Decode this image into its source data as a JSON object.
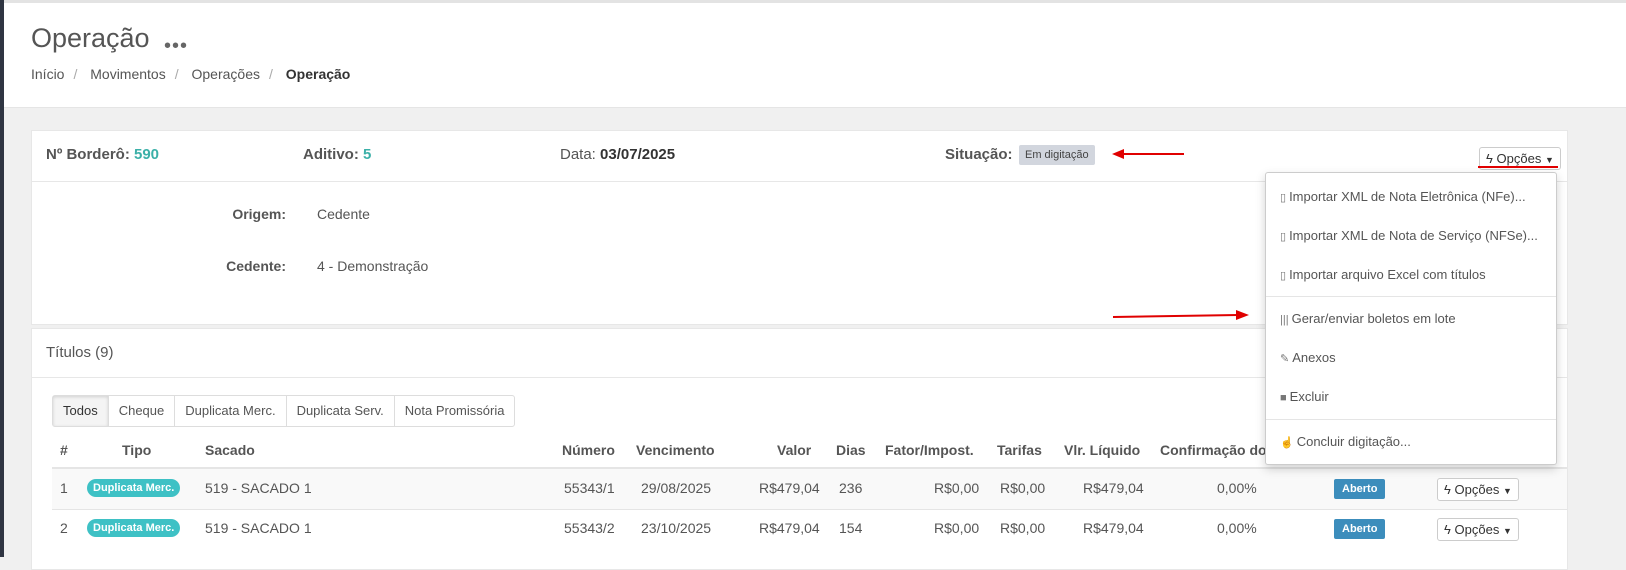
{
  "header": {
    "title": "Operação",
    "menu_icon": "•••",
    "breadcrumb": [
      "Início",
      "Movimentos",
      "Operações",
      "Operação"
    ]
  },
  "info": {
    "bordero_label": "Nº Borderô:",
    "bordero_value": "590",
    "aditivo_label": "Aditivo:",
    "aditivo_value": "5",
    "data_label": "Data:",
    "data_value": "03/07/2025",
    "situacao_label": "Situação:",
    "situacao_value": "Em digitação",
    "options_label": "Opções"
  },
  "form": {
    "origem_label": "Origem:",
    "origem_value": "Cedente",
    "cedente_label": "Cedente:",
    "cedente_value": "4 - Demonstração"
  },
  "titulos": {
    "title": "Títulos (9)",
    "tabs": [
      "Todos",
      "Cheque",
      "Duplicata Merc.",
      "Duplicata Serv.",
      "Nota Promissória"
    ],
    "columns": [
      "#",
      "Tipo",
      "Sacado",
      "Número",
      "Vencimento",
      "Valor",
      "Dias",
      "Fator/Impost.",
      "Tarifas",
      "Vlr. Líquido",
      "Confirmação do"
    ],
    "rows": [
      {
        "n": "1",
        "tipo": "Duplicata Merc.",
        "sacado": "519 - SACADO 1",
        "numero": "55343/1",
        "vencimento": "29/08/2025",
        "valor": "R$479,04",
        "dias": "236",
        "fator": "R$0,00",
        "tarifas": "R$0,00",
        "liquido": "R$479,04",
        "confirmacao": "0,00%",
        "status": "Aberto",
        "options": "Opções"
      },
      {
        "n": "2",
        "tipo": "Duplicata Merc.",
        "sacado": "519 - SACADO 1",
        "numero": "55343/2",
        "vencimento": "23/10/2025",
        "valor": "R$479,04",
        "dias": "154",
        "fator": "R$0,00",
        "tarifas": "R$0,00",
        "liquido": "R$479,04",
        "confirmacao": "0,00%",
        "status": "Aberto",
        "options": "Opções"
      }
    ]
  },
  "dropdown": {
    "items": [
      "Importar XML de Nota Eletrônica (NFe)...",
      "Importar XML de Nota de Serviço (NFSe)...",
      "Importar arquivo Excel com títulos",
      "Gerar/enviar boletos em lote",
      "Anexos",
      "Excluir",
      "Concluir digitação..."
    ]
  },
  "colors": {
    "accent": "#3bb0a8",
    "pill": "#3ec1c5",
    "status_open": "#3c8dbc",
    "annotation": "#e00000"
  }
}
